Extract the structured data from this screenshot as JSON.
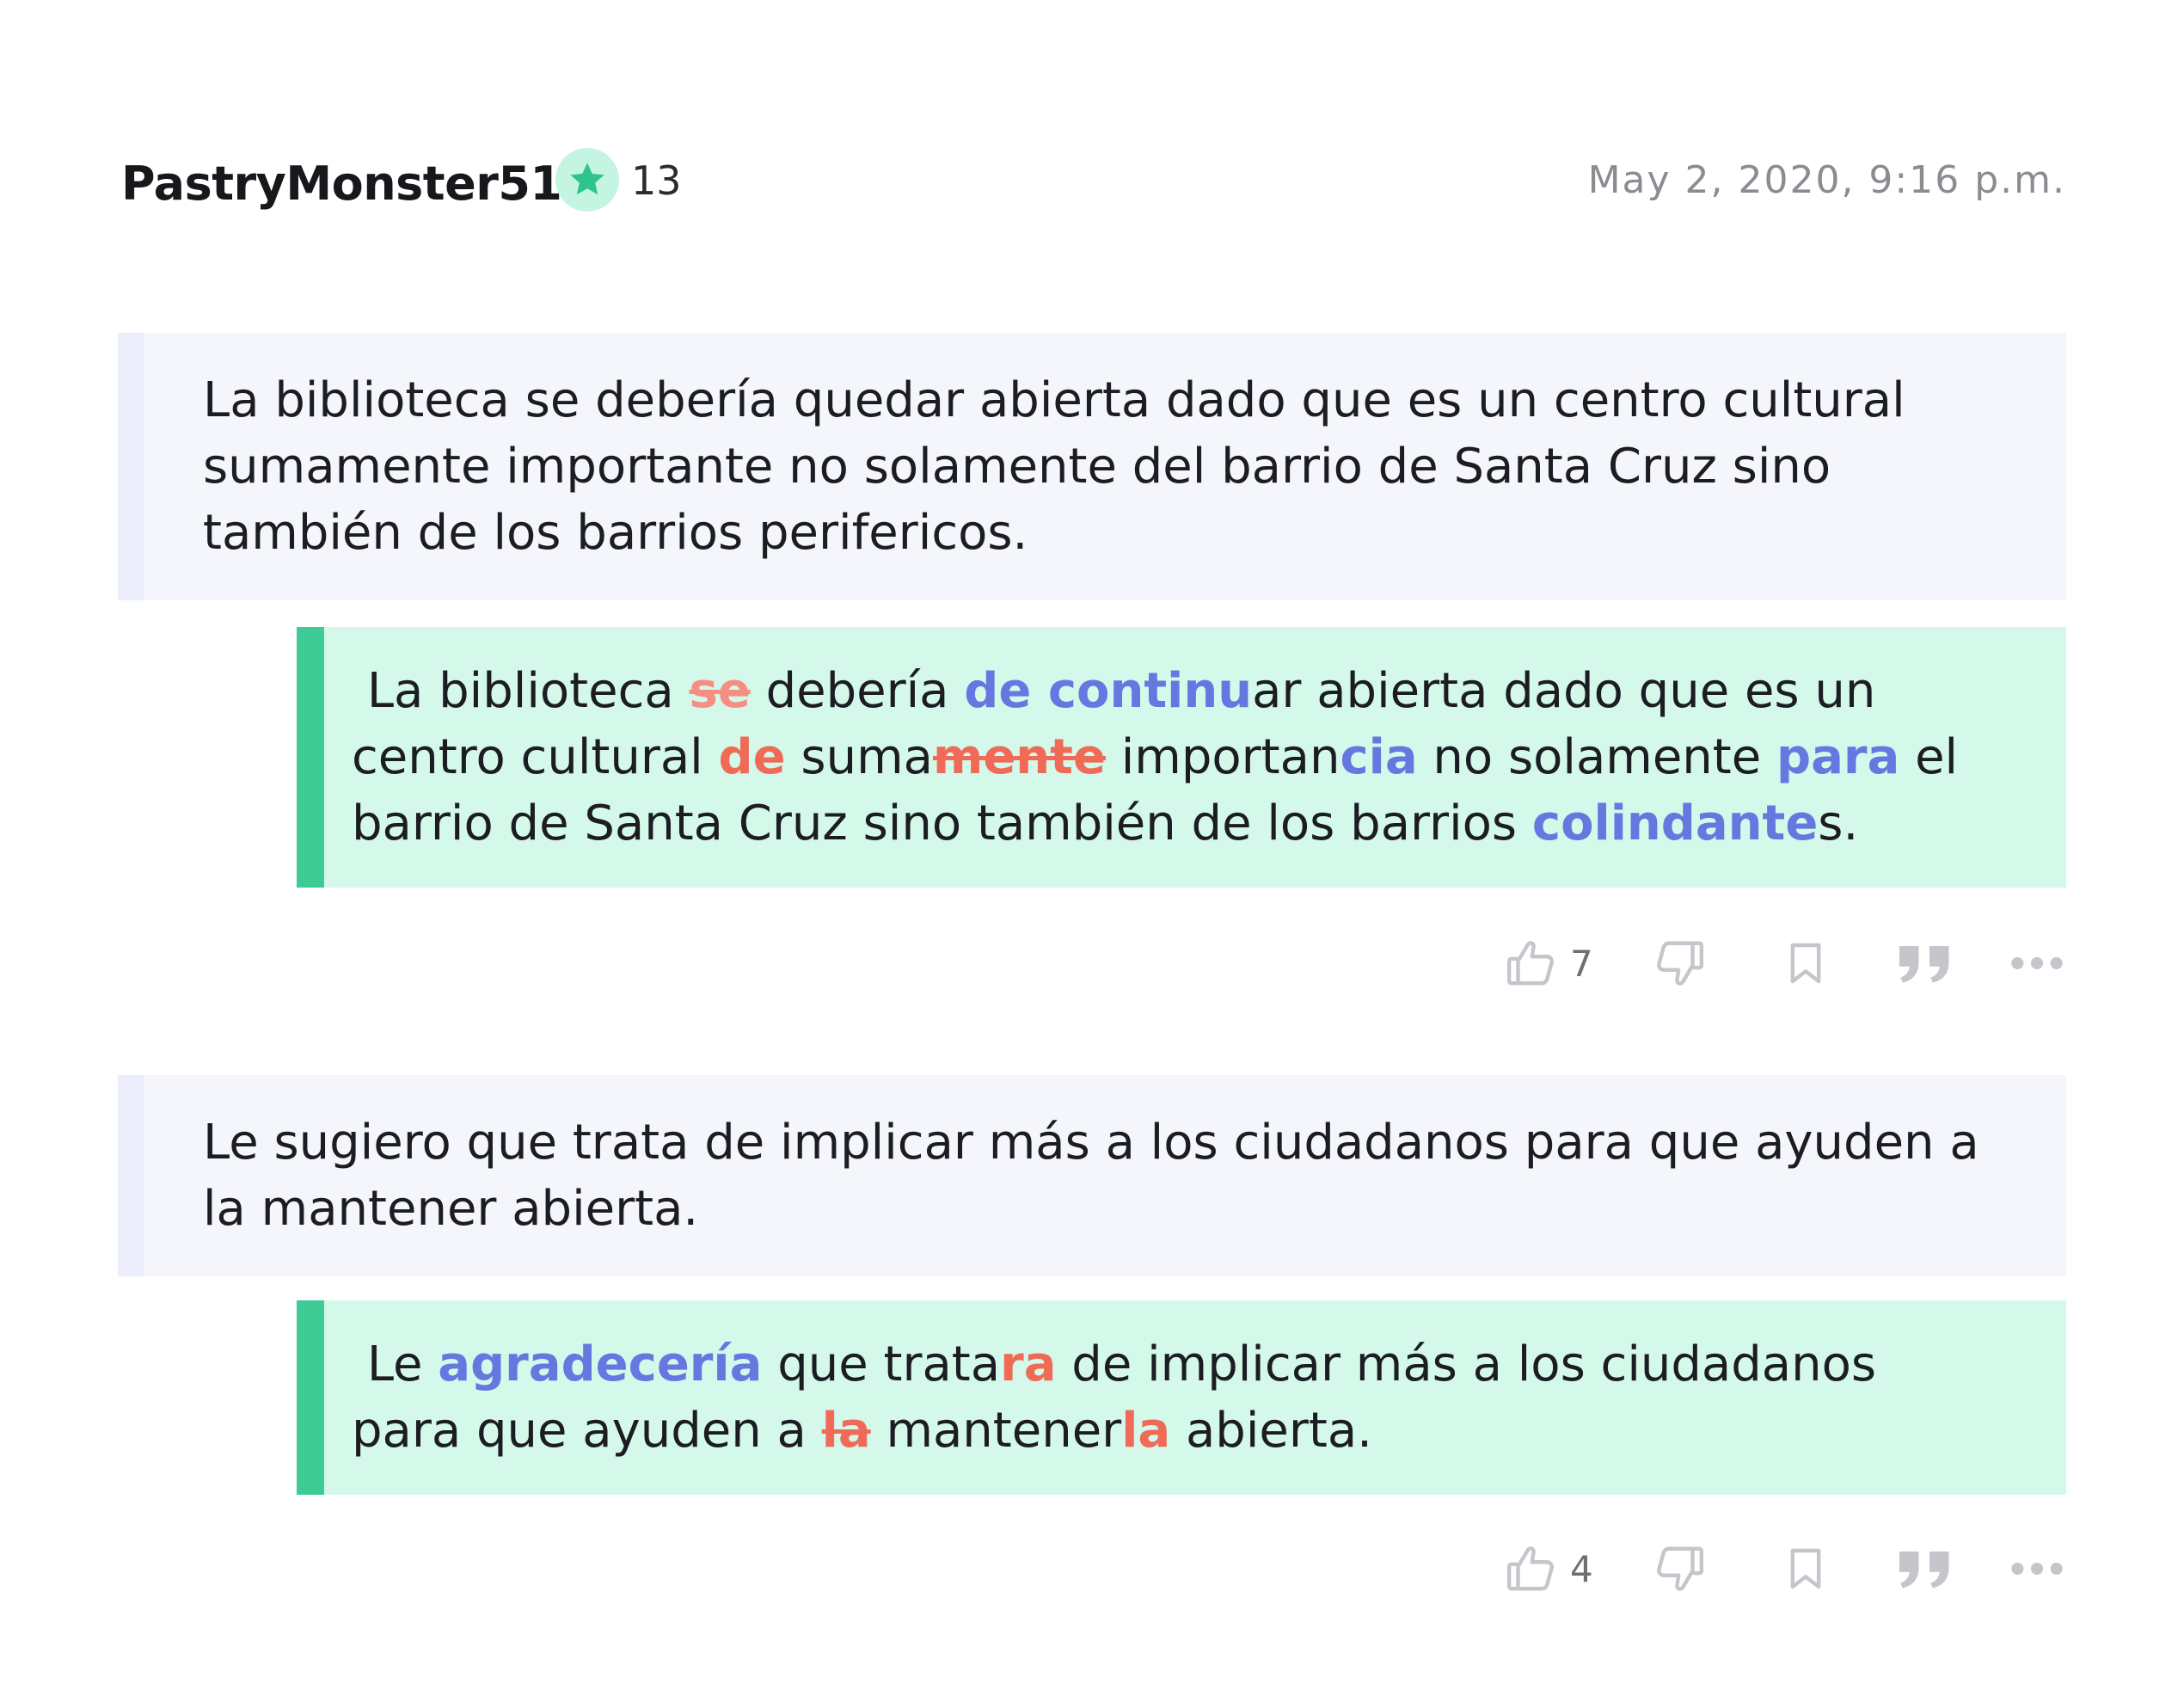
{
  "header": {
    "username": "PastryMonster510",
    "points": "13",
    "timestamp": "May 2, 2020, 9:16 p.m."
  },
  "entries": [
    {
      "original": "La biblioteca se debería quedar abierta dado que es un centro cultural sumamente importante no solamente del barrio de Santa Cruz sino también de los barrios perifericos.",
      "correction": {
        "t0": "La biblioteca ",
        "d0": "se",
        "t1": " debería ",
        "i0": "de continu",
        "t2": "ar abierta dado que es un centro cultural ",
        "a0": "de",
        "t3": " suma",
        "d1": "mente",
        "t4": " importan",
        "i1": "cia",
        "t5": " no solamente ",
        "i2": "para",
        "t6": " el barrio de Santa Cruz sino también de los barrios ",
        "i3": "colindante",
        "t7": "s."
      },
      "likes": "7"
    },
    {
      "original": "Le sugiero que trata de implicar más a los ciudadanos para que ayuden a la mantener abierta.",
      "correction": {
        "t0": "Le ",
        "i0": "agradecería",
        "t1": " que trata",
        "a0": "ra",
        "t2": " de implicar más a los ciudadanos para que ayuden a ",
        "d0": "la",
        "t3": " mantener",
        "a1": "la",
        "t4": " abierta."
      },
      "likes": "4"
    }
  ],
  "icons": {
    "star": "star-icon",
    "like": "thumbs-up-icon",
    "dislike": "thumbs-down-icon",
    "bookmark": "bookmark-icon",
    "quote": "quote-icon",
    "more": "more-options-icon"
  },
  "colors": {
    "accent_green": "#3fcb95",
    "insertion_blue": "#6678e0",
    "deletion_red": "#ef6b57",
    "icon_gray": "#c4c6cc"
  }
}
